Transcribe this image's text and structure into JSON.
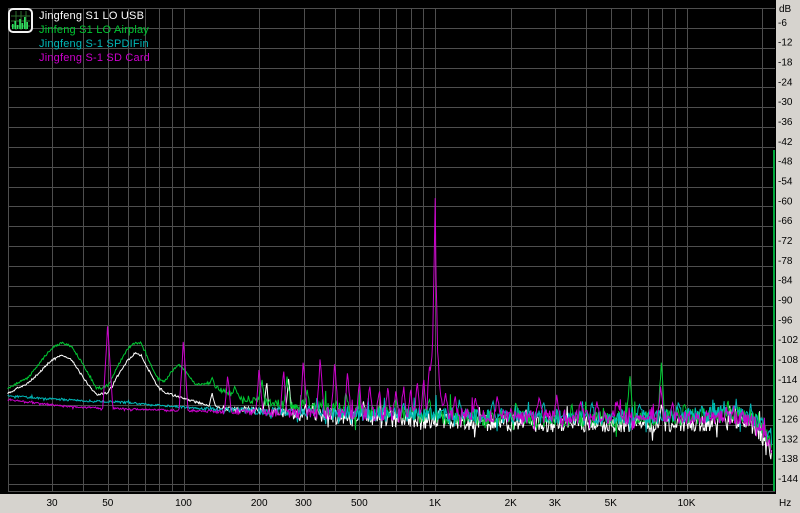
{
  "window": {
    "bg_color": "#d6d3ce",
    "plot_bg_color": "#000000",
    "grid_color": "#4e4e4e",
    "label_color": "#000000",
    "right_edge_line_color": "#00a83c"
  },
  "legend": {
    "icon": "spectrum-analyzer-icon"
  },
  "chart_data": {
    "type": "line",
    "description": "FFT noise spectrum comparison, level in dB vs frequency in Hz (log scale)",
    "x_axis": {
      "scale": "log",
      "unit": "Hz",
      "min": 20,
      "max": 22800,
      "tick_labels": [
        {
          "label": "30",
          "f": 30
        },
        {
          "label": "50",
          "f": 50
        },
        {
          "label": "100",
          "f": 100
        },
        {
          "label": "200",
          "f": 200
        },
        {
          "label": "300",
          "f": 300
        },
        {
          "label": "500",
          "f": 500
        },
        {
          "label": "1K",
          "f": 1000
        },
        {
          "label": "2K",
          "f": 2000
        },
        {
          "label": "3K",
          "f": 3000
        },
        {
          "label": "5K",
          "f": 5000
        },
        {
          "label": "10K",
          "f": 10000
        }
      ],
      "gridline_freqs": [
        20,
        30,
        40,
        50,
        60,
        70,
        80,
        90,
        100,
        200,
        300,
        400,
        500,
        600,
        700,
        800,
        900,
        1000,
        2000,
        3000,
        4000,
        5000,
        6000,
        7000,
        8000,
        9000,
        10000,
        20000
      ]
    },
    "y_axis": {
      "unit": "dB",
      "max": 0,
      "min": -146,
      "grid_step_db": 6,
      "tick_labels": [
        {
          "label": "-6",
          "db": -6
        },
        {
          "label": "-12",
          "db": -12
        },
        {
          "label": "-18",
          "db": -18
        },
        {
          "label": "-24",
          "db": -24
        },
        {
          "label": "-30",
          "db": -30
        },
        {
          "label": "-36",
          "db": -36
        },
        {
          "label": "-42",
          "db": -42
        },
        {
          "label": "-48",
          "db": -48
        },
        {
          "label": "-54",
          "db": -54
        },
        {
          "label": "-60",
          "db": -60
        },
        {
          "label": "-66",
          "db": -66
        },
        {
          "label": "-72",
          "db": -72
        },
        {
          "label": "-78",
          "db": -78
        },
        {
          "label": "-84",
          "db": -84
        },
        {
          "label": "-90",
          "db": -90
        },
        {
          "label": "-96",
          "db": -96
        },
        {
          "label": "-102",
          "db": -102
        },
        {
          "label": "-108",
          "db": -108
        },
        {
          "label": "-114",
          "db": -114
        },
        {
          "label": "-120",
          "db": -120
        },
        {
          "label": "-126",
          "db": -126
        },
        {
          "label": "-132",
          "db": -132
        },
        {
          "label": "-138",
          "db": -138
        },
        {
          "label": "-144",
          "db": -144
        }
      ]
    },
    "series": [
      {
        "name": "Jingfeng S1 LO USB",
        "color": "#ffffff",
        "seed": 101,
        "jitter": 3.0,
        "floor": [
          [
            20,
            -116.5
          ],
          [
            24,
            -113.5
          ],
          [
            27,
            -110
          ],
          [
            30,
            -106.5
          ],
          [
            33,
            -105
          ],
          [
            36,
            -106.5
          ],
          [
            40,
            -112
          ],
          [
            45,
            -117
          ],
          [
            50,
            -116.5
          ],
          [
            55,
            -111
          ],
          [
            60,
            -106.5
          ],
          [
            64,
            -104.5
          ],
          [
            68,
            -105
          ],
          [
            72,
            -109
          ],
          [
            78,
            -114
          ],
          [
            85,
            -116.5
          ],
          [
            95,
            -117.5
          ],
          [
            110,
            -119
          ],
          [
            130,
            -120.5
          ],
          [
            160,
            -121.5
          ],
          [
            220,
            -122
          ],
          [
            350,
            -123
          ],
          [
            700,
            -124.5
          ],
          [
            1500,
            -125.5
          ],
          [
            4000,
            -126
          ],
          [
            9000,
            -126
          ],
          [
            14000,
            -125.5
          ],
          [
            18000,
            -126
          ],
          [
            20000,
            -129
          ],
          [
            21000,
            -131.5
          ],
          [
            21800,
            -135
          ]
        ],
        "peaks": [
          [
            130,
            -116.5,
            3
          ],
          [
            214,
            -113.5,
            3
          ],
          [
            262,
            -112.2,
            3
          ],
          [
            520,
            -119,
            3
          ],
          [
            1050,
            -121,
            3
          ],
          [
            2300,
            -121.5,
            3
          ],
          [
            7950,
            -120,
            3
          ]
        ]
      },
      {
        "name": "Jinfeng S1 LO Airplay",
        "color": "#00c832",
        "seed": 202,
        "jitter": 3.0,
        "floor": [
          [
            20,
            -115
          ],
          [
            24,
            -112
          ],
          [
            27,
            -107
          ],
          [
            30,
            -102.8
          ],
          [
            33,
            -101.2
          ],
          [
            36,
            -102.5
          ],
          [
            40,
            -108
          ],
          [
            45,
            -115
          ],
          [
            50,
            -114.5
          ],
          [
            55,
            -108
          ],
          [
            60,
            -103
          ],
          [
            64,
            -101.2
          ],
          [
            68,
            -101.5
          ],
          [
            72,
            -106
          ],
          [
            78,
            -111.5
          ],
          [
            84,
            -113
          ],
          [
            90,
            -110
          ],
          [
            96,
            -107.8
          ],
          [
            102,
            -110
          ],
          [
            112,
            -114
          ],
          [
            125,
            -113.5
          ],
          [
            140,
            -115.5
          ],
          [
            165,
            -117.5
          ],
          [
            200,
            -119
          ],
          [
            260,
            -120
          ],
          [
            350,
            -121
          ],
          [
            600,
            -122.5
          ],
          [
            1200,
            -123.5
          ],
          [
            3000,
            -124.5
          ],
          [
            7000,
            -124.3
          ],
          [
            11000,
            -123.6
          ],
          [
            16000,
            -123
          ],
          [
            19000,
            -124
          ],
          [
            20300,
            -127
          ],
          [
            21000,
            -130
          ],
          [
            21800,
            -134
          ]
        ],
        "peaks": [
          [
            130,
            -111.8,
            3
          ],
          [
            160,
            -114.5,
            3
          ],
          [
            205,
            -112.5,
            3
          ],
          [
            258,
            -111.5,
            3
          ],
          [
            310,
            -115.5,
            3
          ],
          [
            443,
            -116.5,
            3
          ],
          [
            700,
            -118.5,
            3
          ],
          [
            950,
            -118.5,
            3
          ],
          [
            2100,
            -119.5,
            3
          ],
          [
            3500,
            -120,
            3
          ],
          [
            5950,
            -111.4,
            3.5
          ],
          [
            7950,
            -107.3,
            3.5
          ],
          [
            9800,
            -120,
            3
          ],
          [
            12800,
            -119.5,
            3
          ]
        ]
      },
      {
        "name": "Jingfeng S-1 SPDIFin",
        "color": "#00b8b8",
        "seed": 303,
        "jitter": 2.7,
        "floor": [
          [
            20,
            -117.3
          ],
          [
            28,
            -118.2
          ],
          [
            40,
            -118.8
          ],
          [
            55,
            -119.2
          ],
          [
            75,
            -120
          ],
          [
            110,
            -121
          ],
          [
            180,
            -121.8
          ],
          [
            350,
            -122.4
          ],
          [
            800,
            -123
          ],
          [
            2000,
            -123.4
          ],
          [
            5000,
            -123.8
          ],
          [
            9000,
            -123.4
          ],
          [
            12000,
            -123
          ],
          [
            15000,
            -122.8
          ],
          [
            18000,
            -123.5
          ],
          [
            20000,
            -126
          ],
          [
            21000,
            -128.5
          ],
          [
            21800,
            -131
          ]
        ],
        "peaks": [
          [
            340,
            -118,
            3
          ],
          [
            750,
            -119.5,
            3
          ],
          [
            1250,
            -118.5,
            3
          ],
          [
            1700,
            -119,
            3
          ],
          [
            2700,
            -119.5,
            3
          ],
          [
            4200,
            -119.5,
            3
          ],
          [
            6500,
            -120,
            3
          ],
          [
            9300,
            -119.5,
            3
          ],
          [
            11500,
            -120.5,
            3
          ],
          [
            15500,
            -120.5,
            3
          ]
        ]
      },
      {
        "name": "Jingfeng S-1 SD Card",
        "color": "#cc00cc",
        "seed": 404,
        "jitter": 2.5,
        "floor": [
          [
            20,
            -118.5
          ],
          [
            26,
            -119.5
          ],
          [
            34,
            -120.5
          ],
          [
            45,
            -121
          ],
          [
            60,
            -121.3
          ],
          [
            80,
            -121.6
          ],
          [
            110,
            -121.9
          ],
          [
            160,
            -122.2
          ],
          [
            250,
            -122.5
          ],
          [
            450,
            -122.8
          ],
          [
            900,
            -123
          ],
          [
            2000,
            -123.4
          ],
          [
            5000,
            -123.8
          ],
          [
            9000,
            -124
          ],
          [
            13000,
            -123.7
          ],
          [
            17000,
            -124
          ],
          [
            19500,
            -126.5
          ],
          [
            20700,
            -129.5
          ],
          [
            21800,
            -133
          ]
        ],
        "peaks": [
          [
            50,
            -96.3,
            5
          ],
          [
            100,
            -101,
            4.5
          ],
          [
            150,
            -111.5,
            3.5
          ],
          [
            200,
            -109.5,
            3.5
          ],
          [
            250,
            -110,
            3.5
          ],
          [
            300,
            -107.3,
            3.5
          ],
          [
            350,
            -106.3,
            3.5
          ],
          [
            400,
            -107.8,
            3.5
          ],
          [
            450,
            -110.5,
            3
          ],
          [
            500,
            -113.5,
            3
          ],
          [
            550,
            -114.5,
            3
          ],
          [
            600,
            -116,
            3
          ],
          [
            650,
            -115,
            3
          ],
          [
            700,
            -116,
            3
          ],
          [
            750,
            -114.5,
            3
          ],
          [
            800,
            -115.5,
            3
          ],
          [
            850,
            -113.5,
            3
          ],
          [
            900,
            -112.5,
            3
          ],
          [
            950,
            -111,
            3
          ],
          [
            1000,
            -57.5,
            2.6
          ],
          [
            1000,
            -84,
            4.5
          ],
          [
            1000,
            -103,
            8
          ],
          [
            1100,
            -116.5,
            3
          ],
          [
            1200,
            -117.5,
            3
          ],
          [
            1450,
            -118,
            3
          ],
          [
            1770,
            -117.5,
            3
          ],
          [
            2600,
            -118,
            3
          ],
          [
            3050,
            -117,
            3
          ],
          [
            3800,
            -119,
            3
          ],
          [
            4400,
            -119,
            3
          ],
          [
            5300,
            -119,
            3
          ],
          [
            7900,
            -114.5,
            3
          ],
          [
            8800,
            -119.5,
            3
          ]
        ]
      }
    ]
  }
}
